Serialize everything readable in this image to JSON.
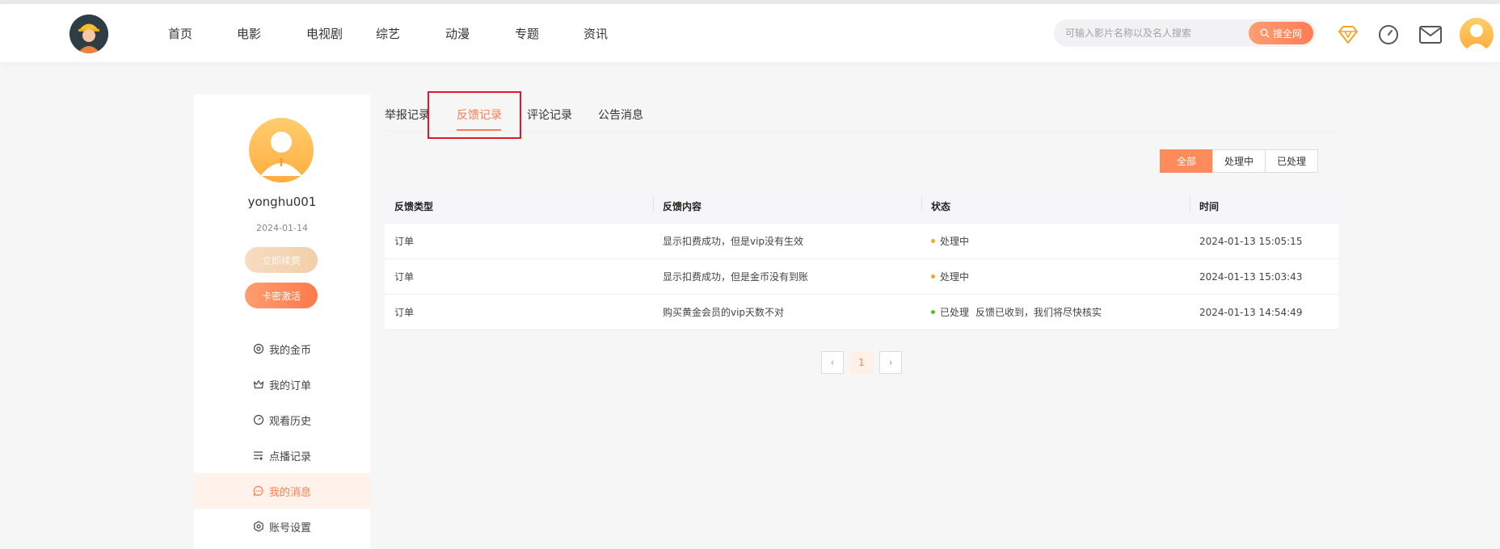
{
  "nav": {
    "items": [
      "首页",
      "电影",
      "电视剧",
      "综艺",
      "动漫",
      "专题",
      "资讯"
    ]
  },
  "search": {
    "placeholder": "可输入影片名称以及名人搜索",
    "button_label": "搜全网"
  },
  "header_icons": [
    "diamond-icon",
    "history-clock-icon",
    "mail-icon",
    "user-avatar"
  ],
  "sidebar": {
    "username": "yonghu001",
    "date": "2024-01-14",
    "renew_label": "立即续费",
    "activate_label": "卡密激活",
    "menu": [
      {
        "label": "我的金币",
        "icon": "coin-icon"
      },
      {
        "label": "我的订单",
        "icon": "crown-icon"
      },
      {
        "label": "观看历史",
        "icon": "history-icon"
      },
      {
        "label": "点播记录",
        "icon": "playlist-icon"
      },
      {
        "label": "我的消息",
        "icon": "message-icon",
        "active": true
      },
      {
        "label": "账号设置",
        "icon": "settings-icon"
      }
    ]
  },
  "tabs": [
    {
      "label": "举报记录"
    },
    {
      "label": "反馈记录",
      "active": true
    },
    {
      "label": "评论记录"
    },
    {
      "label": "公告消息"
    }
  ],
  "filters": [
    {
      "label": "全部",
      "active": true
    },
    {
      "label": "处理中"
    },
    {
      "label": "已处理"
    }
  ],
  "table": {
    "headers": [
      "反馈类型",
      "反馈内容",
      "状态",
      "时间"
    ],
    "rows": [
      {
        "type": "订单",
        "content": "显示扣费成功，但是vip没有生效",
        "status": "处理中",
        "status_color": "#f5a623",
        "reply": "",
        "time": "2024-01-13 15:05:15"
      },
      {
        "type": "订单",
        "content": "显示扣费成功，但是金币没有到账",
        "status": "处理中",
        "status_color": "#f5a623",
        "reply": "",
        "time": "2024-01-13 15:03:43"
      },
      {
        "type": "订单",
        "content": "购买黄金会员的vip天数不对",
        "status": "已处理",
        "status_color": "#52c41a",
        "reply": "反馈已收到，我们将尽快核实",
        "time": "2024-01-13 14:54:49"
      }
    ]
  },
  "pagination": {
    "prev": "‹",
    "current": "1",
    "next": "›"
  },
  "colors": {
    "accent": "#ff7c4c",
    "highlight_box": "#e4162b"
  }
}
